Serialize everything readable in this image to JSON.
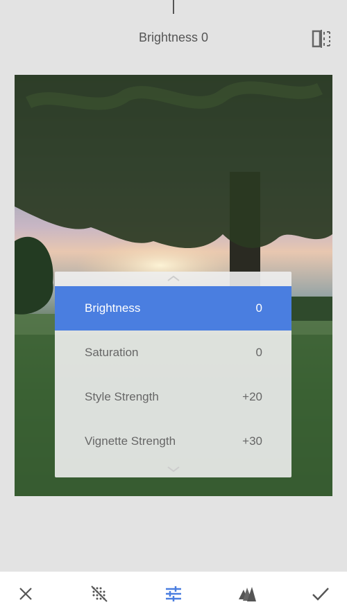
{
  "header": {
    "title": "Brightness 0"
  },
  "panel": {
    "items": [
      {
        "label": "Brightness",
        "value": "0",
        "selected": true
      },
      {
        "label": "Saturation",
        "value": "0",
        "selected": false
      },
      {
        "label": "Style Strength",
        "value": "+20",
        "selected": false
      },
      {
        "label": "Vignette Strength",
        "value": "+30",
        "selected": false
      }
    ]
  },
  "toolbar": {
    "icons": [
      "close-icon",
      "texture-icon",
      "adjust-sliders-icon",
      "styles-icon",
      "checkmark-icon"
    ]
  },
  "colors": {
    "accent": "#4a7ee0",
    "background": "#e3e3e3",
    "text": "#555555"
  }
}
